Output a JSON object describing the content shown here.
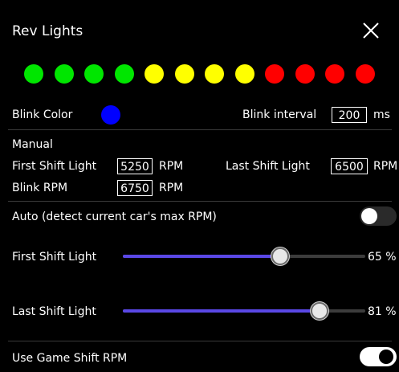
{
  "title": "Rev Lights",
  "lights": [
    "#00e600",
    "#00e600",
    "#00e600",
    "#00e600",
    "#ffff00",
    "#ffff00",
    "#ffff00",
    "#ffff00",
    "#ff0000",
    "#ff0000",
    "#ff0000",
    "#ff0000"
  ],
  "blink": {
    "color_label": "Blink Color",
    "color": "#0000ff",
    "interval_label": "Blink interval",
    "interval_value": "200",
    "interval_unit": "ms"
  },
  "manual": {
    "heading": "Manual",
    "first_label": "First Shift Light",
    "first_value": "5250",
    "last_label": "Last Shift Light",
    "last_value": "6500",
    "blink_label": "Blink RPM",
    "blink_value": "6750",
    "unit": "RPM"
  },
  "auto": {
    "label": "Auto (detect current car's max RPM)",
    "enabled": false,
    "first_label": "First Shift Light",
    "first_percent": 65,
    "first_text": "65 %",
    "last_label": "Last Shift Light",
    "last_percent": 81,
    "last_text": "81 %"
  },
  "game_shift": {
    "label": "Use Game Shift RPM",
    "enabled": true
  },
  "colors": {
    "slider_fill": "#5a48e6",
    "toggle_on": "#ffffff",
    "toggle_off": "#2a2a2a"
  }
}
